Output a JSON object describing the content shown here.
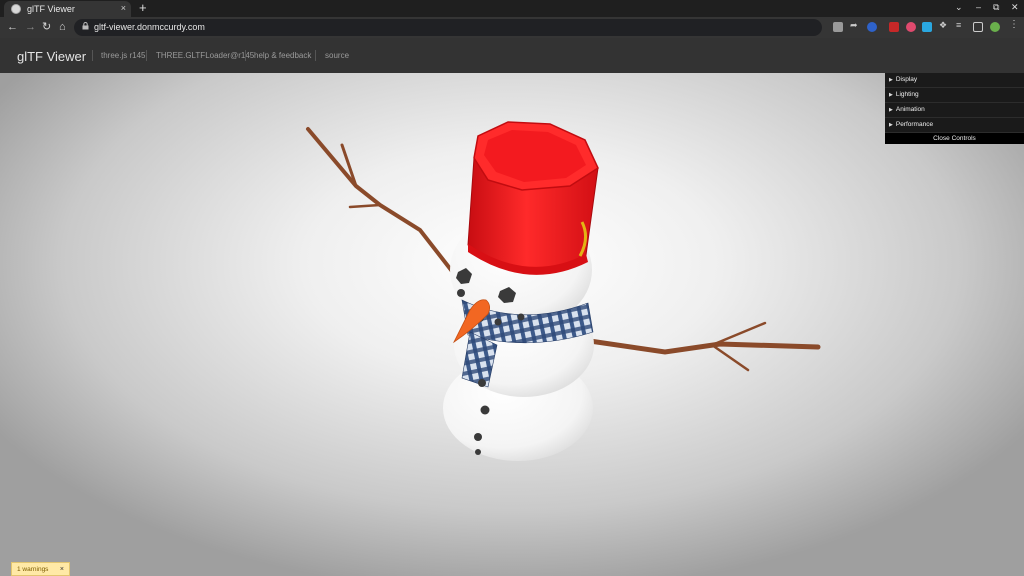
{
  "browser": {
    "tab_title": "glTF Viewer",
    "tab_close": "×",
    "new_tab": "+",
    "url": "gltf-viewer.donmccurdy.com",
    "win_controls": [
      "⌄",
      "–",
      "⧉",
      "✕"
    ]
  },
  "header": {
    "title": "glTF Viewer",
    "links": [
      "three.js r145",
      "THREE.GLTFLoader@r145",
      "help & feedback",
      "source"
    ]
  },
  "gui": {
    "folders": [
      "Display",
      "Lighting",
      "Animation",
      "Performance"
    ],
    "close_label": "Close Controls"
  },
  "warnings": {
    "label": "1 warnings",
    "close": "×"
  },
  "colors": {
    "hat": "#e8141a",
    "snow": "#ffffff",
    "carrot": "#f26722",
    "scarf": "#3d5a8a",
    "branch": "#8a4a2a",
    "coal": "#3a3a3a"
  }
}
